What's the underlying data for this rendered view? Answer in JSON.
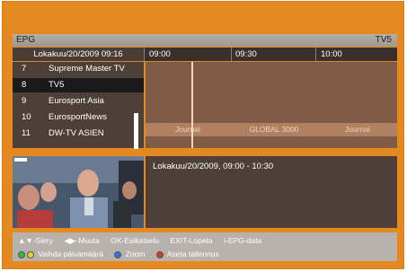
{
  "header": {
    "title": "EPG",
    "channel": "TV5"
  },
  "date_label": "Lokakuu/20/2009 09:16",
  "timeline": [
    "09:00",
    "09:30",
    "10:00"
  ],
  "channels": [
    {
      "num": "7",
      "name": "Supreme Master TV"
    },
    {
      "num": "8",
      "name": "TV5"
    },
    {
      "num": "9",
      "name": "Eurosport Asia"
    },
    {
      "num": "10",
      "name": "EurosportNews"
    },
    {
      "num": "11",
      "name": "DW-TV ASIEN"
    }
  ],
  "selected_channel_index": 1,
  "programs_row_11": [
    "Journal",
    "GLOBAL 3000",
    "Journal"
  ],
  "info": {
    "time": "Lokakuu/20/2009, 09:00 - 10:30"
  },
  "footer": {
    "row1": [
      "▲▼-Siirry",
      "◀▶-Muuta",
      "OK-Esikatselu",
      "EXIT-Lopeta",
      "i-EPG-data"
    ],
    "row2": {
      "swap_date": "Vaihda päivämäärä",
      "zoom": "Zoom",
      "record": "Aseta tallennus"
    }
  },
  "colors": {
    "frame": "#e4891f",
    "green_key": "#2fbf3a",
    "yellow_key": "#e8d32a",
    "blue_key": "#3a6fe0",
    "red_key": "#d83a2a"
  }
}
